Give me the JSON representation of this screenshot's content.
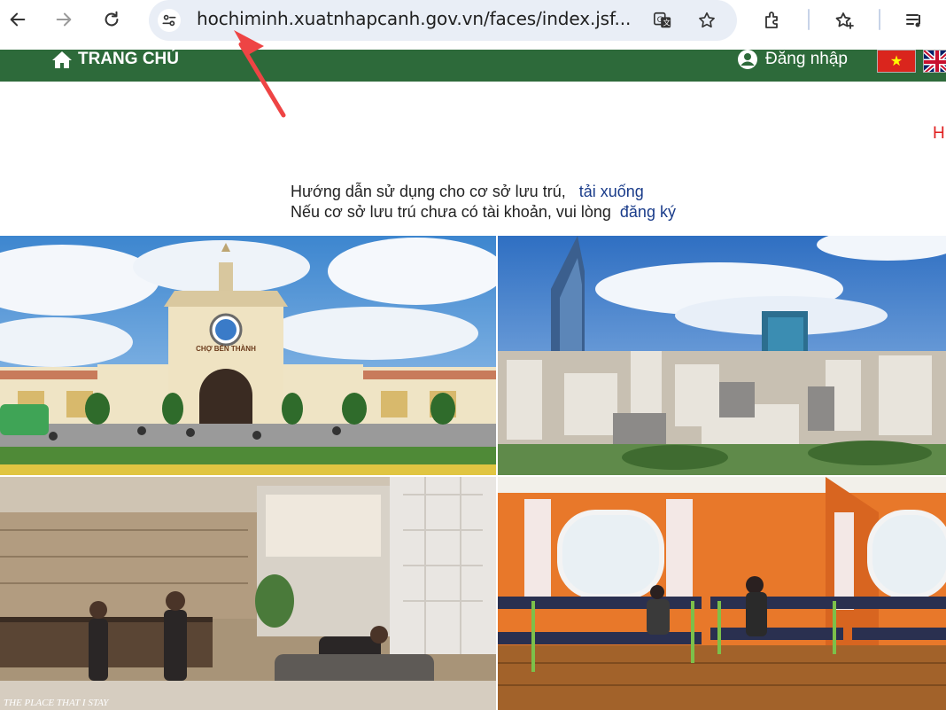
{
  "browser": {
    "url": "hochiminh.xuatnhapcanh.gov.vn/faces/index.jsf...",
    "icons": [
      "back-arrow-icon",
      "forward-arrow-icon",
      "reload-icon",
      "site-settings-icon",
      "translate-icon",
      "bookmark-star-icon",
      "extensions-icon",
      "bookmarks-icon",
      "reading-list-icon"
    ]
  },
  "header": {
    "home_label": "TRANG CHỦ",
    "login_label": "Đăng nhập",
    "side_letter": "H"
  },
  "guide": {
    "line1_text": "Hướng dẫn sử dụng cho cơ sở lưu trú,",
    "line1_link": "tải xuống",
    "line2_text": "Nếu cơ sở lưu trú chưa có tài khoản, vui lòng",
    "line2_link": "đăng ký"
  },
  "photos": {
    "market_sign": "CHỢ BẾN THÀNH",
    "lobby_caption": "THE PLACE THAT I STAY"
  },
  "colors": {
    "header_green": "#2d6a3a",
    "link_blue": "#1a3c8a",
    "annotation_red": "#ee4444"
  }
}
